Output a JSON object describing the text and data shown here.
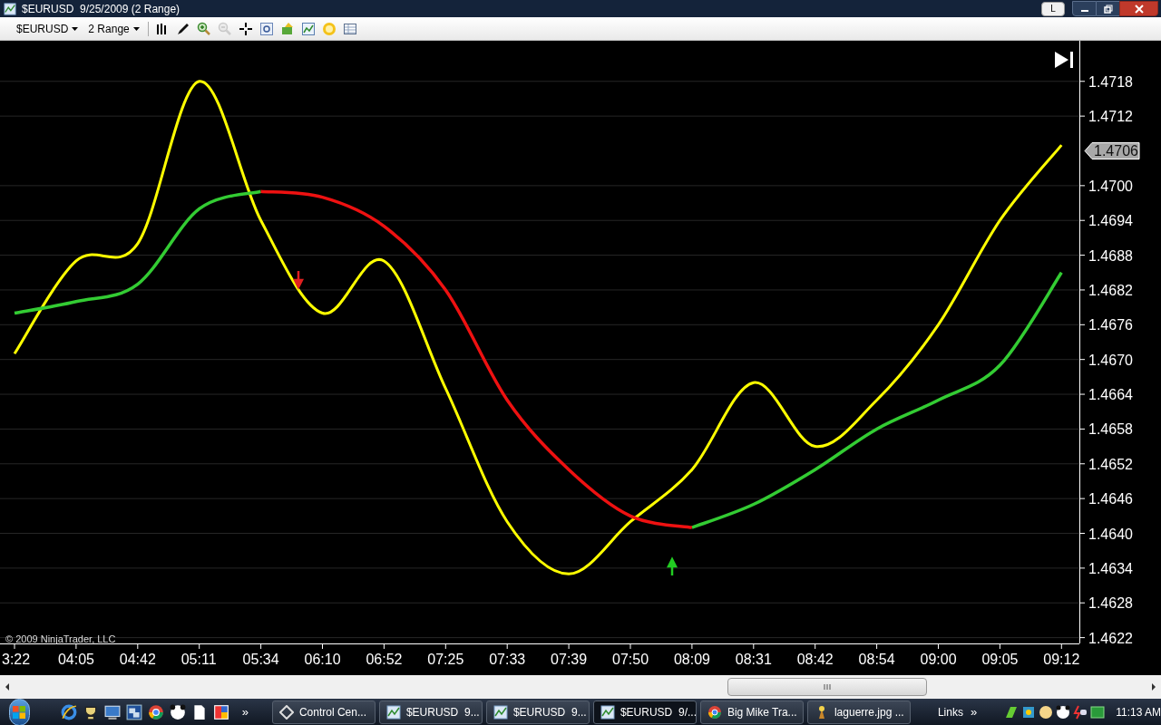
{
  "window": {
    "title": "$EURUSD  9/25/2009 (2 Range)",
    "link_button": "L"
  },
  "toolbar": {
    "instrument": "$EURUSD",
    "interval": "2 Range",
    "tools": [
      {
        "kind": "bars",
        "disabled": false
      },
      {
        "kind": "pencil",
        "disabled": false
      },
      {
        "kind": "zoom-in",
        "disabled": false
      },
      {
        "kind": "zoom-out",
        "disabled": true
      },
      {
        "kind": "crosshair",
        "disabled": false
      },
      {
        "kind": "properties",
        "disabled": false
      },
      {
        "kind": "strategy",
        "disabled": false
      },
      {
        "kind": "indicators",
        "disabled": false
      },
      {
        "kind": "coin",
        "disabled": false
      },
      {
        "kind": "data-box",
        "disabled": false
      }
    ]
  },
  "chart": {
    "copyright": "© 2009 NinjaTrader, LLC",
    "chart_data": {
      "type": "line",
      "categories": [
        "3:22",
        "04:05",
        "04:42",
        "05:11",
        "05:34",
        "06:10",
        "06:52",
        "07:25",
        "07:33",
        "07:39",
        "07:50",
        "08:09",
        "08:31",
        "08:42",
        "08:54",
        "09:00",
        "09:05",
        "09:12"
      ],
      "series": [
        {
          "color": "#ffff00",
          "values": [
            1.4671,
            1.4687,
            1.469,
            1.4718,
            1.4694,
            1.4678,
            1.4687,
            1.4665,
            1.4642,
            1.4633,
            1.4642,
            1.4651,
            1.4666,
            1.4655,
            1.4663,
            1.4676,
            1.4694,
            1.4707
          ]
        },
        {
          "color": "#33cc33",
          "values": [
            1.4678,
            1.468,
            1.4683,
            1.4696,
            1.4699,
            null,
            null,
            null,
            null,
            null,
            null,
            1.4641,
            1.4645,
            1.4651,
            1.4658,
            1.4663,
            1.4669,
            1.4685
          ]
        },
        {
          "color": "#ee1111",
          "values": [
            null,
            null,
            null,
            null,
            1.4699,
            1.4698,
            1.4693,
            1.4682,
            1.4663,
            1.4651,
            1.4643,
            1.4641,
            null,
            null,
            null,
            null,
            null,
            null
          ]
        }
      ],
      "yticks": [
        {
          "value": 1.4718,
          "label": "1.4718"
        },
        {
          "value": 1.4712,
          "label": "1.4712"
        },
        {
          "value": 1.47,
          "label": "1.4700"
        },
        {
          "value": 1.4694,
          "label": "1.4694"
        },
        {
          "value": 1.4688,
          "label": "1.4688"
        },
        {
          "value": 1.4682,
          "label": "1.4682"
        },
        {
          "value": 1.4676,
          "label": "1.4676"
        },
        {
          "value": 1.467,
          "label": "1.4670"
        },
        {
          "value": 1.4664,
          "label": "1.4664"
        },
        {
          "value": 1.4658,
          "label": "1.4658"
        },
        {
          "value": 1.4652,
          "label": "1.4652"
        },
        {
          "value": 1.4646,
          "label": "1.4646"
        },
        {
          "value": 1.464,
          "label": "1.4640"
        },
        {
          "value": 1.4634,
          "label": "1.4634"
        },
        {
          "value": 1.4628,
          "label": "1.4628"
        },
        {
          "value": 1.4622,
          "label": "1.4622"
        }
      ],
      "ylim": [
        1.4621,
        1.4725
      ],
      "grid": true
    },
    "last_price": "1.4706"
  },
  "taskbar": {
    "more_quick_launch": "»",
    "tasks": [
      {
        "label": "Control Cen...",
        "kind": "control",
        "selected": false
      },
      {
        "label": "$EURUSD  9...",
        "kind": "chart",
        "selected": false
      },
      {
        "label": "$EURUSD  9...",
        "kind": "chart",
        "selected": false
      },
      {
        "label": "$EURUSD  9/...",
        "kind": "chart",
        "selected": true
      },
      {
        "label": "Big Mike Tra...",
        "kind": "browser",
        "selected": false
      },
      {
        "label": "laguerre.jpg ...",
        "kind": "image",
        "selected": false
      }
    ],
    "links": "Links",
    "more_links": "»",
    "clock": "11:13 AM"
  }
}
